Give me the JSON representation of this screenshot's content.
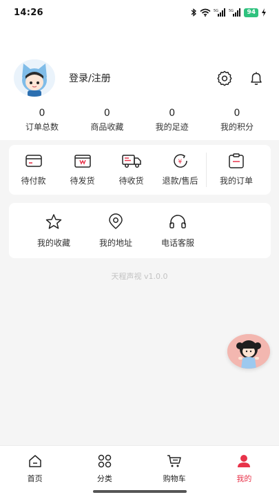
{
  "status_bar": {
    "time": "14:26",
    "battery": "94",
    "icons": [
      "bluetooth-icon",
      "wifi-icon",
      "signal-5g-icon",
      "signal-5g-icon",
      "charging-icon"
    ]
  },
  "profile": {
    "login_label": "登录/注册",
    "icons": [
      "settings-gear-icon",
      "notification-bell-icon"
    ]
  },
  "stats": [
    {
      "value": "0",
      "label": "订单总数"
    },
    {
      "value": "0",
      "label": "商品收藏"
    },
    {
      "value": "0",
      "label": "我的足迹"
    },
    {
      "value": "0",
      "label": "我的积分"
    }
  ],
  "orders": [
    {
      "label": "待付款",
      "icon": "card-icon"
    },
    {
      "label": "待发货",
      "icon": "box-icon"
    },
    {
      "label": "待收货",
      "icon": "truck-icon"
    },
    {
      "label": "退款/售后",
      "icon": "refund-icon"
    },
    {
      "label": "我的订单",
      "icon": "clipboard-icon"
    }
  ],
  "services": [
    {
      "label": "我的收藏",
      "icon": "star-icon"
    },
    {
      "label": "我的地址",
      "icon": "location-pin-icon"
    },
    {
      "label": "电话客服",
      "icon": "headset-icon"
    }
  ],
  "version": "天程声视 v1.0.0",
  "tabbar": {
    "active_color": "#e8334a",
    "items": [
      {
        "label": "首页",
        "icon": "home-icon"
      },
      {
        "label": "分类",
        "icon": "grid-icon"
      },
      {
        "label": "购物车",
        "icon": "cart-icon"
      },
      {
        "label": "我的",
        "icon": "user-icon"
      }
    ],
    "active_index": 3
  }
}
